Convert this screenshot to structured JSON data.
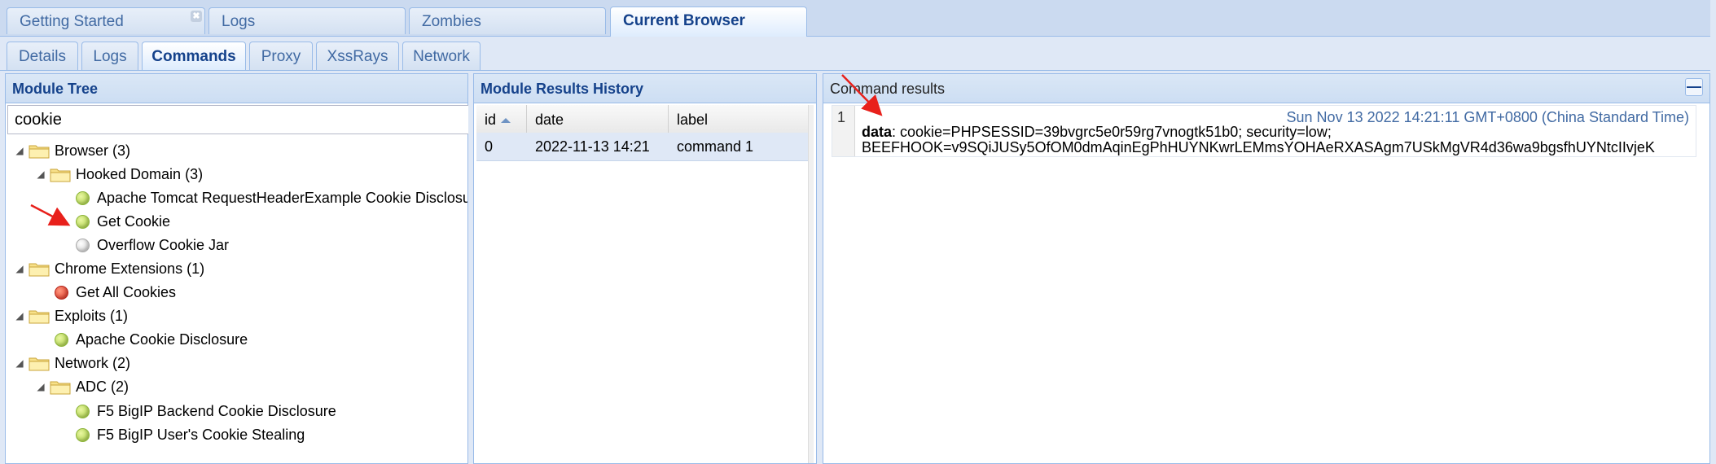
{
  "top_tabs": [
    {
      "label": "Getting Started"
    },
    {
      "label": "Logs"
    },
    {
      "label": "Zombies"
    },
    {
      "label": "Current Browser"
    }
  ],
  "sub_tabs": [
    {
      "label": "Details"
    },
    {
      "label": "Logs"
    },
    {
      "label": "Commands"
    },
    {
      "label": "Proxy"
    },
    {
      "label": "XssRays"
    },
    {
      "label": "Network"
    }
  ],
  "module_tree": {
    "title": "Module Tree",
    "search_value": "cookie",
    "nodes": [
      {
        "label": "Browser (3)"
      },
      {
        "label": "Hooked Domain (3)"
      },
      {
        "label": "Apache Tomcat RequestHeaderExample Cookie Disclosur"
      },
      {
        "label": "Get Cookie"
      },
      {
        "label": "Overflow Cookie Jar"
      },
      {
        "label": "Chrome Extensions (1)"
      },
      {
        "label": "Get All Cookies"
      },
      {
        "label": "Exploits (1)"
      },
      {
        "label": "Apache Cookie Disclosure"
      },
      {
        "label": "Network (2)"
      },
      {
        "label": "ADC (2)"
      },
      {
        "label": "F5 BigIP Backend Cookie Disclosure"
      },
      {
        "label": "F5 BigIP User's Cookie Stealing"
      }
    ]
  },
  "results_history": {
    "title": "Module Results History",
    "columns": [
      "id",
      "date",
      "label"
    ],
    "rows": [
      {
        "id": "0",
        "date": "2022-11-13 14:21",
        "label": "command 1"
      }
    ]
  },
  "command_results": {
    "title": "Command results",
    "entries": [
      {
        "number": "1",
        "timestamp": "Sun Nov 13 2022 14:21:11 GMT+0800 (China Standard Time)",
        "key": "data",
        "value": ": cookie=PHPSESSID=39bvgrc5e0r59rg7vnogtk51b0; security=low;",
        "value2": "BEEFHOOK=v9SQiJUSy5OfOM0dmAqinEgPhHUYNKwrLEMmsYOHAeRXASAgm7USkMgVR4d36wa9bgsfhUYNtcIIvjeK"
      }
    ]
  },
  "colors": {
    "header_text": "#15428b",
    "tab_text": "#416aa3",
    "panel_border": "#99bbe8",
    "annotation_arrow": "#e8201b"
  }
}
